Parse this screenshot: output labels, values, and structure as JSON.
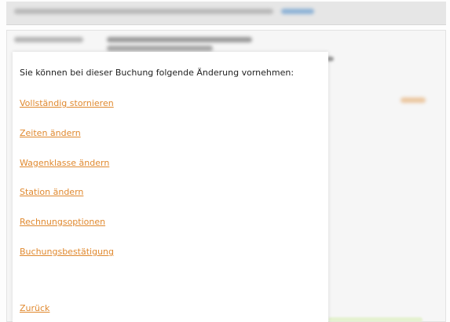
{
  "dialog": {
    "intro": "Sie können bei dieser Buchung folgende Änderung vornehmen:",
    "options": [
      "Vollständig stornieren",
      "Zeiten ändern",
      "Wagenklasse ändern",
      "Station ändern",
      "Rechnungsoptionen",
      "Buchungsbestätigung"
    ],
    "back": "Zurück"
  },
  "colors": {
    "link": "#e0892f",
    "text": "#222222",
    "background": "#f6f6f6"
  }
}
